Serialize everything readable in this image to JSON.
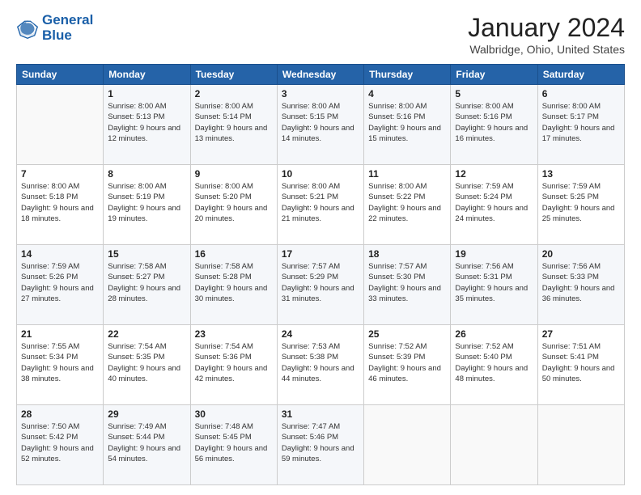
{
  "header": {
    "logo_line1": "General",
    "logo_line2": "Blue",
    "title": "January 2024",
    "location": "Walbridge, Ohio, United States"
  },
  "columns": [
    "Sunday",
    "Monday",
    "Tuesday",
    "Wednesday",
    "Thursday",
    "Friday",
    "Saturday"
  ],
  "weeks": [
    [
      {
        "day": "",
        "sunrise": "",
        "sunset": "",
        "daylight": ""
      },
      {
        "day": "1",
        "sunrise": "Sunrise: 8:00 AM",
        "sunset": "Sunset: 5:13 PM",
        "daylight": "Daylight: 9 hours and 12 minutes."
      },
      {
        "day": "2",
        "sunrise": "Sunrise: 8:00 AM",
        "sunset": "Sunset: 5:14 PM",
        "daylight": "Daylight: 9 hours and 13 minutes."
      },
      {
        "day": "3",
        "sunrise": "Sunrise: 8:00 AM",
        "sunset": "Sunset: 5:15 PM",
        "daylight": "Daylight: 9 hours and 14 minutes."
      },
      {
        "day": "4",
        "sunrise": "Sunrise: 8:00 AM",
        "sunset": "Sunset: 5:16 PM",
        "daylight": "Daylight: 9 hours and 15 minutes."
      },
      {
        "day": "5",
        "sunrise": "Sunrise: 8:00 AM",
        "sunset": "Sunset: 5:16 PM",
        "daylight": "Daylight: 9 hours and 16 minutes."
      },
      {
        "day": "6",
        "sunrise": "Sunrise: 8:00 AM",
        "sunset": "Sunset: 5:17 PM",
        "daylight": "Daylight: 9 hours and 17 minutes."
      }
    ],
    [
      {
        "day": "7",
        "sunrise": "Sunrise: 8:00 AM",
        "sunset": "Sunset: 5:18 PM",
        "daylight": "Daylight: 9 hours and 18 minutes."
      },
      {
        "day": "8",
        "sunrise": "Sunrise: 8:00 AM",
        "sunset": "Sunset: 5:19 PM",
        "daylight": "Daylight: 9 hours and 19 minutes."
      },
      {
        "day": "9",
        "sunrise": "Sunrise: 8:00 AM",
        "sunset": "Sunset: 5:20 PM",
        "daylight": "Daylight: 9 hours and 20 minutes."
      },
      {
        "day": "10",
        "sunrise": "Sunrise: 8:00 AM",
        "sunset": "Sunset: 5:21 PM",
        "daylight": "Daylight: 9 hours and 21 minutes."
      },
      {
        "day": "11",
        "sunrise": "Sunrise: 8:00 AM",
        "sunset": "Sunset: 5:22 PM",
        "daylight": "Daylight: 9 hours and 22 minutes."
      },
      {
        "day": "12",
        "sunrise": "Sunrise: 7:59 AM",
        "sunset": "Sunset: 5:24 PM",
        "daylight": "Daylight: 9 hours and 24 minutes."
      },
      {
        "day": "13",
        "sunrise": "Sunrise: 7:59 AM",
        "sunset": "Sunset: 5:25 PM",
        "daylight": "Daylight: 9 hours and 25 minutes."
      }
    ],
    [
      {
        "day": "14",
        "sunrise": "Sunrise: 7:59 AM",
        "sunset": "Sunset: 5:26 PM",
        "daylight": "Daylight: 9 hours and 27 minutes."
      },
      {
        "day": "15",
        "sunrise": "Sunrise: 7:58 AM",
        "sunset": "Sunset: 5:27 PM",
        "daylight": "Daylight: 9 hours and 28 minutes."
      },
      {
        "day": "16",
        "sunrise": "Sunrise: 7:58 AM",
        "sunset": "Sunset: 5:28 PM",
        "daylight": "Daylight: 9 hours and 30 minutes."
      },
      {
        "day": "17",
        "sunrise": "Sunrise: 7:57 AM",
        "sunset": "Sunset: 5:29 PM",
        "daylight": "Daylight: 9 hours and 31 minutes."
      },
      {
        "day": "18",
        "sunrise": "Sunrise: 7:57 AM",
        "sunset": "Sunset: 5:30 PM",
        "daylight": "Daylight: 9 hours and 33 minutes."
      },
      {
        "day": "19",
        "sunrise": "Sunrise: 7:56 AM",
        "sunset": "Sunset: 5:31 PM",
        "daylight": "Daylight: 9 hours and 35 minutes."
      },
      {
        "day": "20",
        "sunrise": "Sunrise: 7:56 AM",
        "sunset": "Sunset: 5:33 PM",
        "daylight": "Daylight: 9 hours and 36 minutes."
      }
    ],
    [
      {
        "day": "21",
        "sunrise": "Sunrise: 7:55 AM",
        "sunset": "Sunset: 5:34 PM",
        "daylight": "Daylight: 9 hours and 38 minutes."
      },
      {
        "day": "22",
        "sunrise": "Sunrise: 7:54 AM",
        "sunset": "Sunset: 5:35 PM",
        "daylight": "Daylight: 9 hours and 40 minutes."
      },
      {
        "day": "23",
        "sunrise": "Sunrise: 7:54 AM",
        "sunset": "Sunset: 5:36 PM",
        "daylight": "Daylight: 9 hours and 42 minutes."
      },
      {
        "day": "24",
        "sunrise": "Sunrise: 7:53 AM",
        "sunset": "Sunset: 5:38 PM",
        "daylight": "Daylight: 9 hours and 44 minutes."
      },
      {
        "day": "25",
        "sunrise": "Sunrise: 7:52 AM",
        "sunset": "Sunset: 5:39 PM",
        "daylight": "Daylight: 9 hours and 46 minutes."
      },
      {
        "day": "26",
        "sunrise": "Sunrise: 7:52 AM",
        "sunset": "Sunset: 5:40 PM",
        "daylight": "Daylight: 9 hours and 48 minutes."
      },
      {
        "day": "27",
        "sunrise": "Sunrise: 7:51 AM",
        "sunset": "Sunset: 5:41 PM",
        "daylight": "Daylight: 9 hours and 50 minutes."
      }
    ],
    [
      {
        "day": "28",
        "sunrise": "Sunrise: 7:50 AM",
        "sunset": "Sunset: 5:42 PM",
        "daylight": "Daylight: 9 hours and 52 minutes."
      },
      {
        "day": "29",
        "sunrise": "Sunrise: 7:49 AM",
        "sunset": "Sunset: 5:44 PM",
        "daylight": "Daylight: 9 hours and 54 minutes."
      },
      {
        "day": "30",
        "sunrise": "Sunrise: 7:48 AM",
        "sunset": "Sunset: 5:45 PM",
        "daylight": "Daylight: 9 hours and 56 minutes."
      },
      {
        "day": "31",
        "sunrise": "Sunrise: 7:47 AM",
        "sunset": "Sunset: 5:46 PM",
        "daylight": "Daylight: 9 hours and 59 minutes."
      },
      {
        "day": "",
        "sunrise": "",
        "sunset": "",
        "daylight": ""
      },
      {
        "day": "",
        "sunrise": "",
        "sunset": "",
        "daylight": ""
      },
      {
        "day": "",
        "sunrise": "",
        "sunset": "",
        "daylight": ""
      }
    ]
  ]
}
